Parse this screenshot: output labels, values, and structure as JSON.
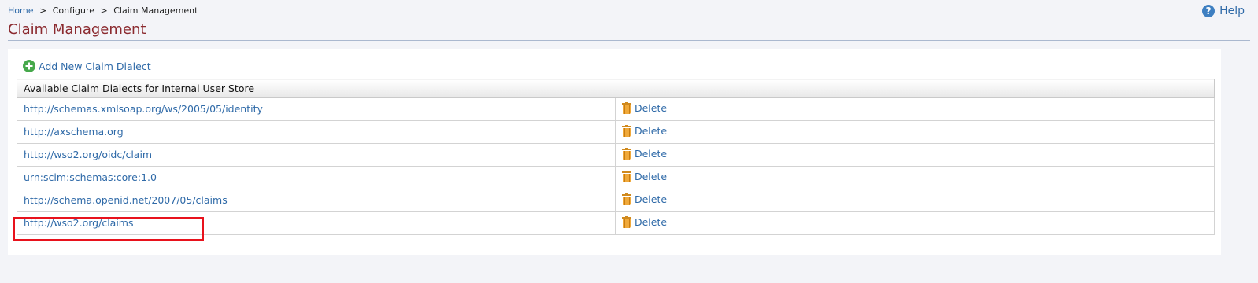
{
  "breadcrumb": {
    "home": "Home",
    "separator": ">",
    "configure": "Configure",
    "current": "Claim Management"
  },
  "help": {
    "label": "Help",
    "icon": "help-icon"
  },
  "page": {
    "title": "Claim Management"
  },
  "actions": {
    "add_dialect": "Add New Claim Dialect"
  },
  "table": {
    "header": "Available Claim Dialects for Internal User Store",
    "delete_label": "Delete",
    "rows": [
      "http://schemas.xmlsoap.org/ws/2005/05/identity",
      "http://axschema.org",
      "http://wso2.org/oidc/claim",
      "urn:scim:schemas:core:1.0",
      "http://schema.openid.net/2007/05/claims",
      "http://wso2.org/claims"
    ]
  },
  "colors": {
    "title": "#8b2a2f",
    "link": "#2f6aa8",
    "highlight": "#e8121c",
    "add_icon": "#46a84b",
    "trash_icon": "#f0a93a"
  }
}
